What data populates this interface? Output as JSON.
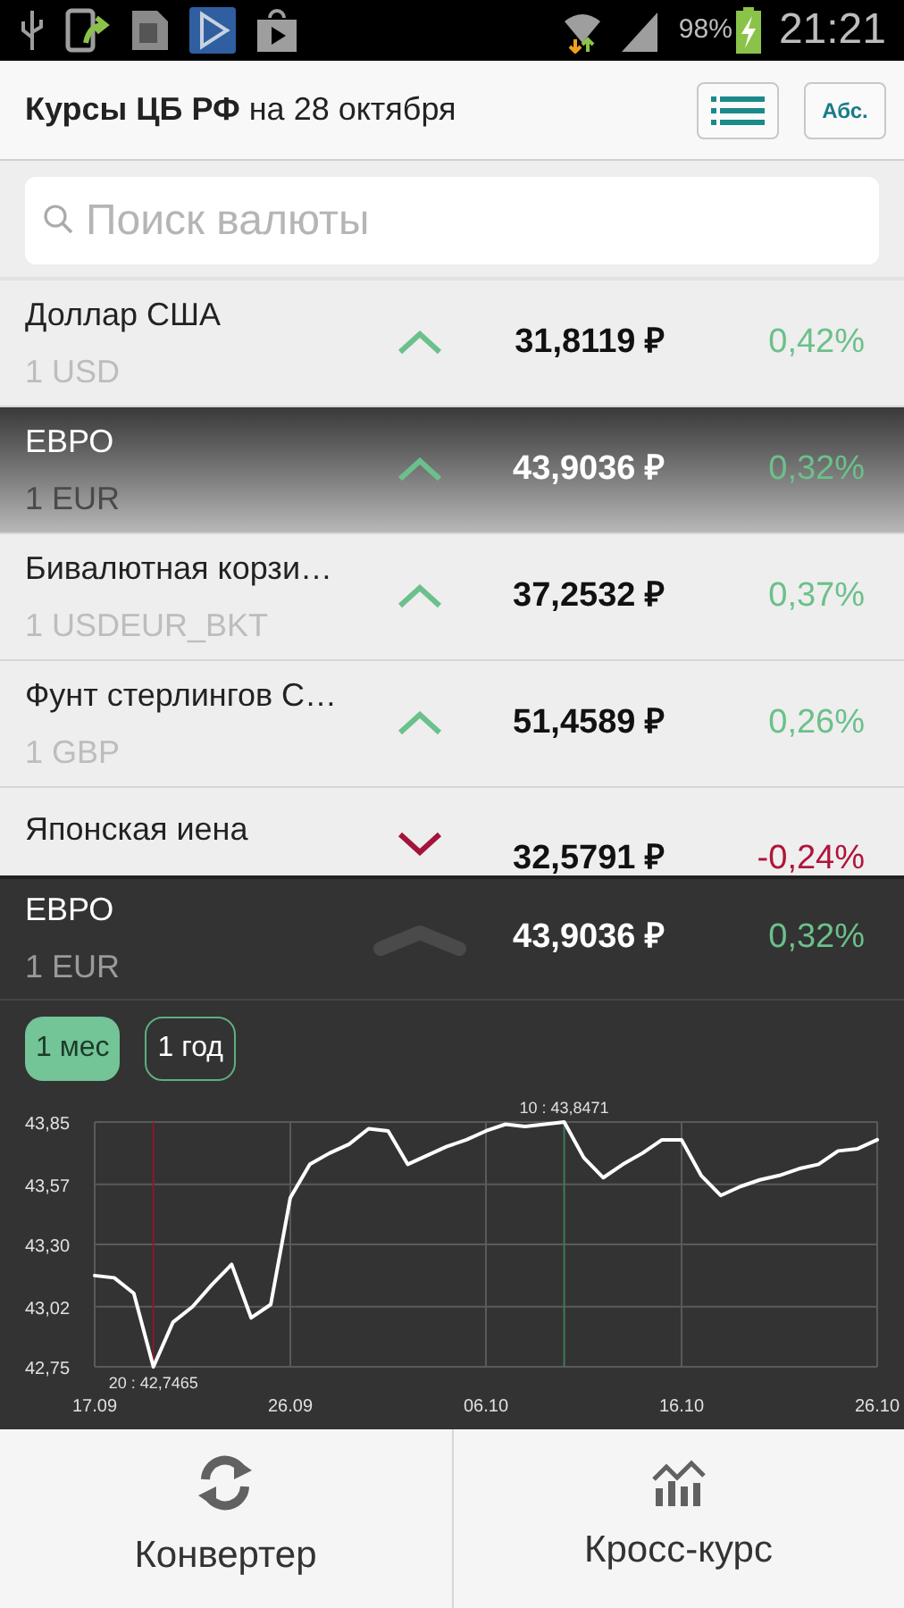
{
  "status_bar": {
    "battery": "98%",
    "time": "21:21"
  },
  "header": {
    "title": "**Курсы ЦБ РФ** на 28 октября",
    "abs_button": "Абс."
  },
  "search": {
    "placeholder": "Поиск валюты"
  },
  "currencies": [
    {
      "name": "Доллар США",
      "unit": "1 USD",
      "rising": true,
      "rate": "31,8119 ₽",
      "change": "0,42%",
      "selected": false
    },
    {
      "name": "ЕВРО",
      "unit": "1 EUR",
      "rising": true,
      "rate": "43,9036 ₽",
      "change": "0,32%",
      "selected": true
    },
    {
      "name": "Бивалютная корзи…",
      "unit": "1 USDEUR_BKT",
      "rising": true,
      "rate": "37,2532 ₽",
      "change": "0,37%",
      "selected": false
    },
    {
      "name": "Фунт стерлингов С…",
      "unit": "1 GBP",
      "rising": true,
      "rate": "51,4589 ₽",
      "change": "0,26%",
      "selected": false
    },
    {
      "name": "Японская иена",
      "rising": false,
      "rate": "32,5791 ₽",
      "change": "-0,24%",
      "selected": false
    }
  ],
  "detail": {
    "name": "ЕВРО",
    "unit": "1 EUR",
    "rate": "43,9036 ₽",
    "change": "0,32%",
    "periods": [
      {
        "label": "1 мес",
        "selected": true
      },
      {
        "label": "1 год",
        "selected": false
      }
    ],
    "chart_data": {
      "type": "line",
      "categories": [
        "17.09",
        null,
        null,
        null,
        null,
        null,
        null,
        null,
        null,
        null,
        "26.09",
        null,
        null,
        null,
        null,
        null,
        null,
        null,
        null,
        null,
        "06.10",
        null,
        null,
        null,
        null,
        null,
        null,
        null,
        null,
        null,
        "16.10",
        null,
        null,
        null,
        null,
        null,
        null,
        null,
        null,
        null,
        "26.10"
      ],
      "series": [
        {
          "color": "#ffffff",
          "values": [
            43.16,
            43.15,
            43.08,
            42.75,
            42.95,
            43.02,
            43.12,
            43.21,
            42.97,
            43.03,
            43.51,
            43.66,
            43.71,
            43.75,
            43.82,
            43.81,
            43.66,
            43.7,
            43.74,
            43.77,
            43.81,
            43.84,
            43.83,
            43.84,
            43.85,
            43.69,
            43.6,
            43.66,
            43.71,
            43.77,
            43.77,
            43.61,
            43.52,
            43.56,
            43.59,
            43.61,
            43.64,
            43.66,
            43.72,
            43.73,
            43.77
          ]
        }
      ],
      "ylim": [
        42.75,
        43.85
      ],
      "grid": true,
      "yticks": [
        {
          "value": 43.85,
          "label": "43,85"
        },
        {
          "value": 43.57,
          "label": "43,57"
        },
        {
          "value": 43.3,
          "label": "43,30"
        },
        {
          "value": 43.02,
          "label": "43,02"
        },
        {
          "value": 42.75,
          "label": "42,75"
        }
      ],
      "annotations": [
        {
          "y": 42.75,
          "text": "20 : 42,7465"
        },
        {
          "y": 43.85,
          "text": "10 : 43,8471"
        }
      ]
    }
  },
  "bottom_tabs": [
    {
      "label": "Конвертер",
      "kind": "converter"
    },
    {
      "label": "Кросс-курс",
      "kind": "cross"
    }
  ]
}
